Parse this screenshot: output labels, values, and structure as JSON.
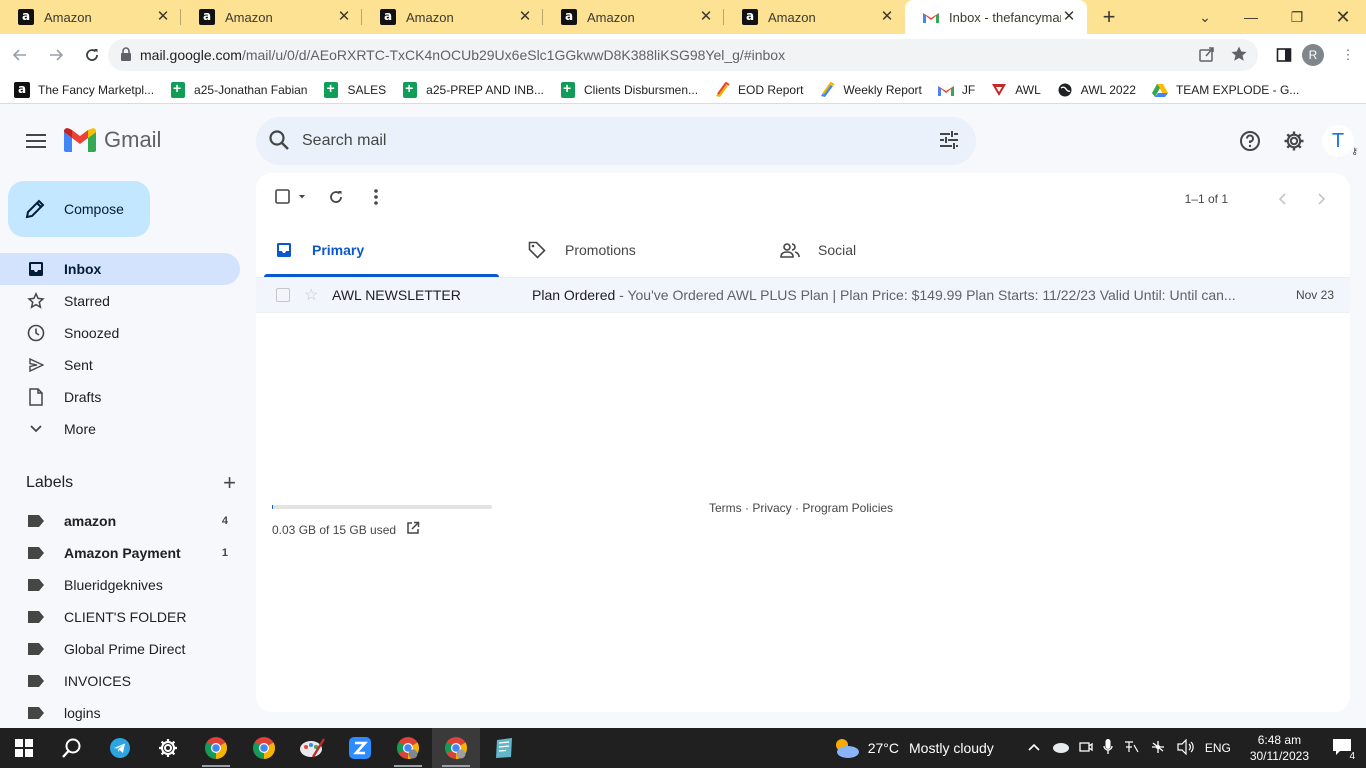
{
  "browser": {
    "tabs": [
      {
        "title": "Amazon",
        "icon": "amazon-icon"
      },
      {
        "title": "Amazon",
        "icon": "amazon-icon"
      },
      {
        "title": "Amazon",
        "icon": "amazon-icon"
      },
      {
        "title": "Amazon",
        "icon": "amazon-icon"
      },
      {
        "title": "Amazon",
        "icon": "amazon-icon"
      },
      {
        "title": "Inbox - thefancymark",
        "icon": "gmail-icon"
      }
    ],
    "url_host": "mail.google.com",
    "url_path": "/mail/u/0/d/AEoRXRTC-TxCK4nOCUb29Ux6eSlc1GGkwwD8K388liKSG98Yel_g/#inbox",
    "profile_initial": "R",
    "tabstrip_color": "#fde293"
  },
  "bookmarks": [
    {
      "label": "The Fancy Marketpl...",
      "icon": "amazon-icon"
    },
    {
      "label": "a25-Jonathan Fabian",
      "icon": "sheets-icon"
    },
    {
      "label": "SALES",
      "icon": "sheets-icon"
    },
    {
      "label": "a25-PREP AND INB...",
      "icon": "sheets-icon"
    },
    {
      "label": "Clients Disbursmen...",
      "icon": "sheets-icon"
    },
    {
      "label": "EOD Report",
      "icon": "zapier-icon"
    },
    {
      "label": "Weekly Report",
      "icon": "zapier-icon"
    },
    {
      "label": "JF",
      "icon": "gmail-icon"
    },
    {
      "label": "AWL",
      "icon": "awl-icon"
    },
    {
      "label": "AWL 2022",
      "icon": "globe-icon"
    },
    {
      "label": "TEAM EXPLODE - G...",
      "icon": "drive-icon"
    }
  ],
  "gmail": {
    "app_name": "Gmail",
    "search_placeholder": "Search mail",
    "account_initial": "T",
    "compose_label": "Compose",
    "nav": [
      {
        "label": "Inbox",
        "icon": "inbox-icon",
        "active": true
      },
      {
        "label": "Starred",
        "icon": "star-icon"
      },
      {
        "label": "Snoozed",
        "icon": "clock-icon"
      },
      {
        "label": "Sent",
        "icon": "send-icon"
      },
      {
        "label": "Drafts",
        "icon": "draft-icon"
      },
      {
        "label": "More",
        "icon": "chevron-down-icon"
      }
    ],
    "labels_title": "Labels",
    "labels": [
      {
        "label": "amazon",
        "count": "4",
        "bold": true
      },
      {
        "label": "Amazon Payment",
        "count": "1",
        "bold": true
      },
      {
        "label": "Blueridgeknives",
        "count": ""
      },
      {
        "label": "CLIENT'S FOLDER",
        "count": ""
      },
      {
        "label": "Global Prime Direct",
        "count": ""
      },
      {
        "label": "INVOICES",
        "count": ""
      },
      {
        "label": "logins",
        "count": ""
      }
    ],
    "pagination": "1–1 of 1",
    "inbox_tabs": [
      {
        "label": "Primary",
        "icon": "inbox-icon",
        "active": true
      },
      {
        "label": "Promotions",
        "icon": "tag-icon"
      },
      {
        "label": "Social",
        "icon": "people-icon"
      }
    ],
    "emails": [
      {
        "sender": "AWL NEWSLETTER",
        "subject": "Plan Ordered",
        "snippet": " - You've Ordered AWL PLUS Plan | Plan Price: $149.99 Plan Starts: 11/22/23 Valid Until: Until can...",
        "date": "Nov 23"
      }
    ],
    "storage_text": "0.03 GB of 15 GB used",
    "storage_fraction": 0.002,
    "footer": "Terms · Privacy · Program Policies"
  },
  "taskbar": {
    "weather_temp": "27°C",
    "weather_desc": "Mostly cloudy",
    "language": "ENG",
    "time": "6:48 am",
    "date": "30/11/2023",
    "notifications": "4"
  }
}
